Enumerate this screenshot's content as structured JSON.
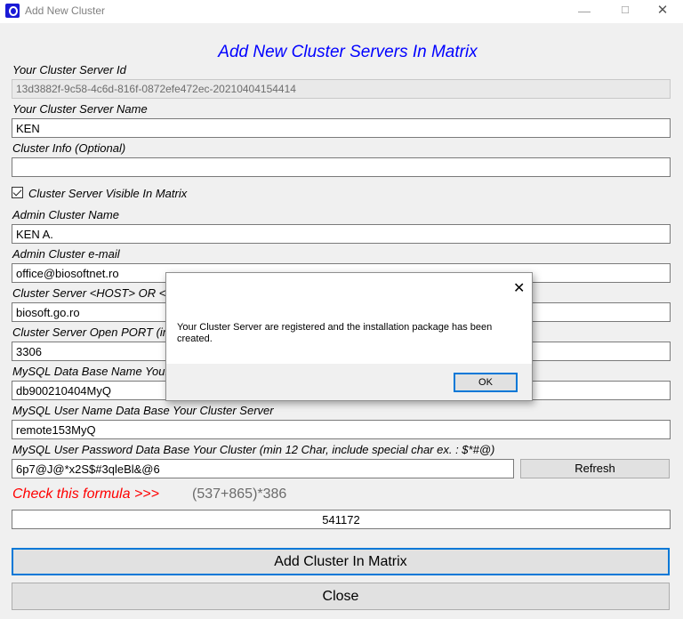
{
  "window": {
    "title": "Add New Cluster",
    "minimize": "—",
    "maximize": "☐",
    "close": "✕"
  },
  "heading": "Add New Cluster Servers In Matrix",
  "form": {
    "server_id_label": "Your Cluster Server Id",
    "server_id_value": "13d3882f-9c58-4c6d-816f-0872efe472ec-20210404154414",
    "server_name_label": "Your Cluster Server Name",
    "server_name_value": "KEN",
    "cluster_info_label": "Cluster Info (Optional)",
    "cluster_info_value": "",
    "visible_label": "Cluster Server Visible In Matrix",
    "visible_checked": true,
    "admin_name_label": "Admin Cluster Name",
    "admin_name_value": "KEN A.",
    "admin_email_label": "Admin Cluster e-mail",
    "admin_email_value": "office@biosoftnet.ro",
    "host_label": "Cluster Server <HOST> OR <",
    "host_value": "biosoft.go.ro",
    "port_label": "Cluster Server Open PORT (in",
    "port_value": "3306",
    "db_name_label": "MySQL Data Base Name Your",
    "db_name_value": "db900210404MyQ",
    "db_user_label": "MySQL User Name Data Base Your Cluster Server",
    "db_user_value": "remote153MyQ",
    "db_pass_label": "MySQL User Password Data Base Your Cluster (min 12 Char, include special char ex. : $*#@)",
    "db_pass_value": "6p7@J@*x2S$#3qleBl&@6",
    "refresh_button": "Refresh",
    "formula_label": "Check this formula >>>",
    "formula_expression": "(537+865)*386",
    "formula_answer": "541172",
    "add_button": "Add Cluster In Matrix",
    "close_button": "Close"
  },
  "dialog": {
    "message": "Your Cluster Server are registered and the installation package has been created.",
    "close_icon": "✕",
    "ok_button": "OK"
  }
}
